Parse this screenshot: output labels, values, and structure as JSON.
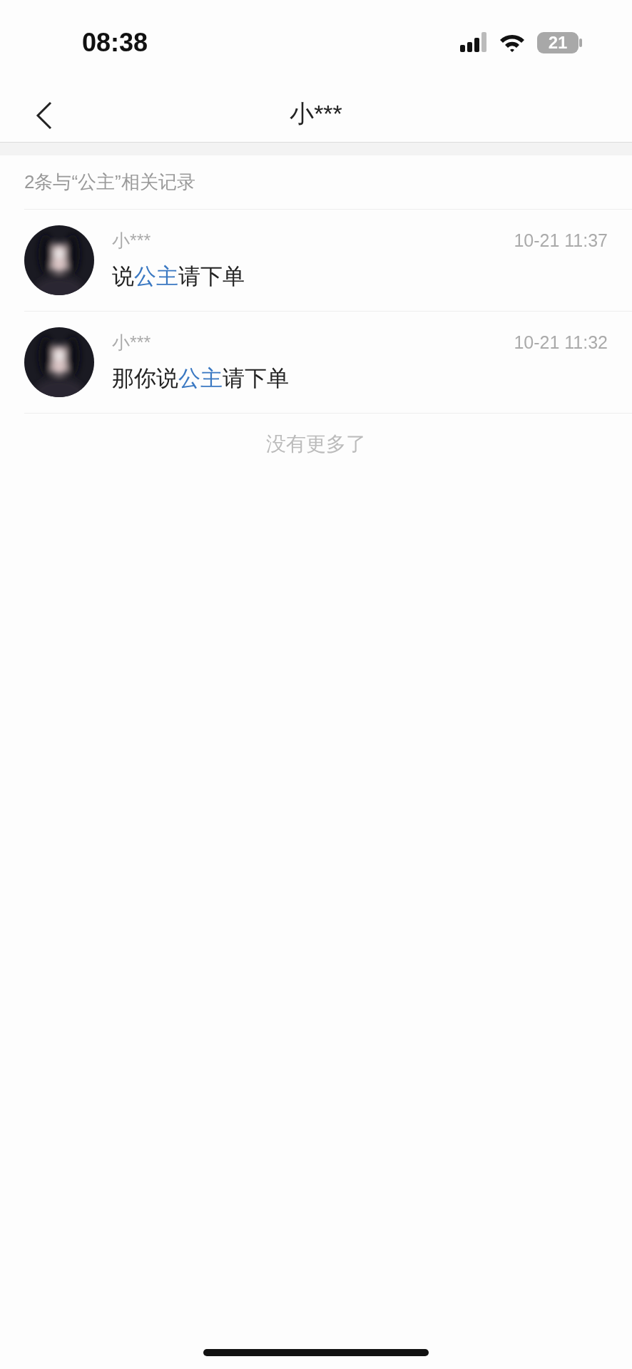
{
  "status_bar": {
    "time": "08:38",
    "battery": "21"
  },
  "nav": {
    "title": "小***"
  },
  "summary": "2条与“公主”相关记录",
  "results": [
    {
      "name": "小***",
      "time": "10-21 11:37",
      "message": [
        {
          "text": "说",
          "highlight": false
        },
        {
          "text": "公主",
          "highlight": true
        },
        {
          "text": "请下单",
          "highlight": false
        }
      ]
    },
    {
      "name": "小***",
      "time": "10-21 11:32",
      "message": [
        {
          "text": "那你说",
          "highlight": false
        },
        {
          "text": "公主",
          "highlight": true
        },
        {
          "text": "请下单",
          "highlight": false
        }
      ]
    }
  ],
  "footer": "没有更多了"
}
